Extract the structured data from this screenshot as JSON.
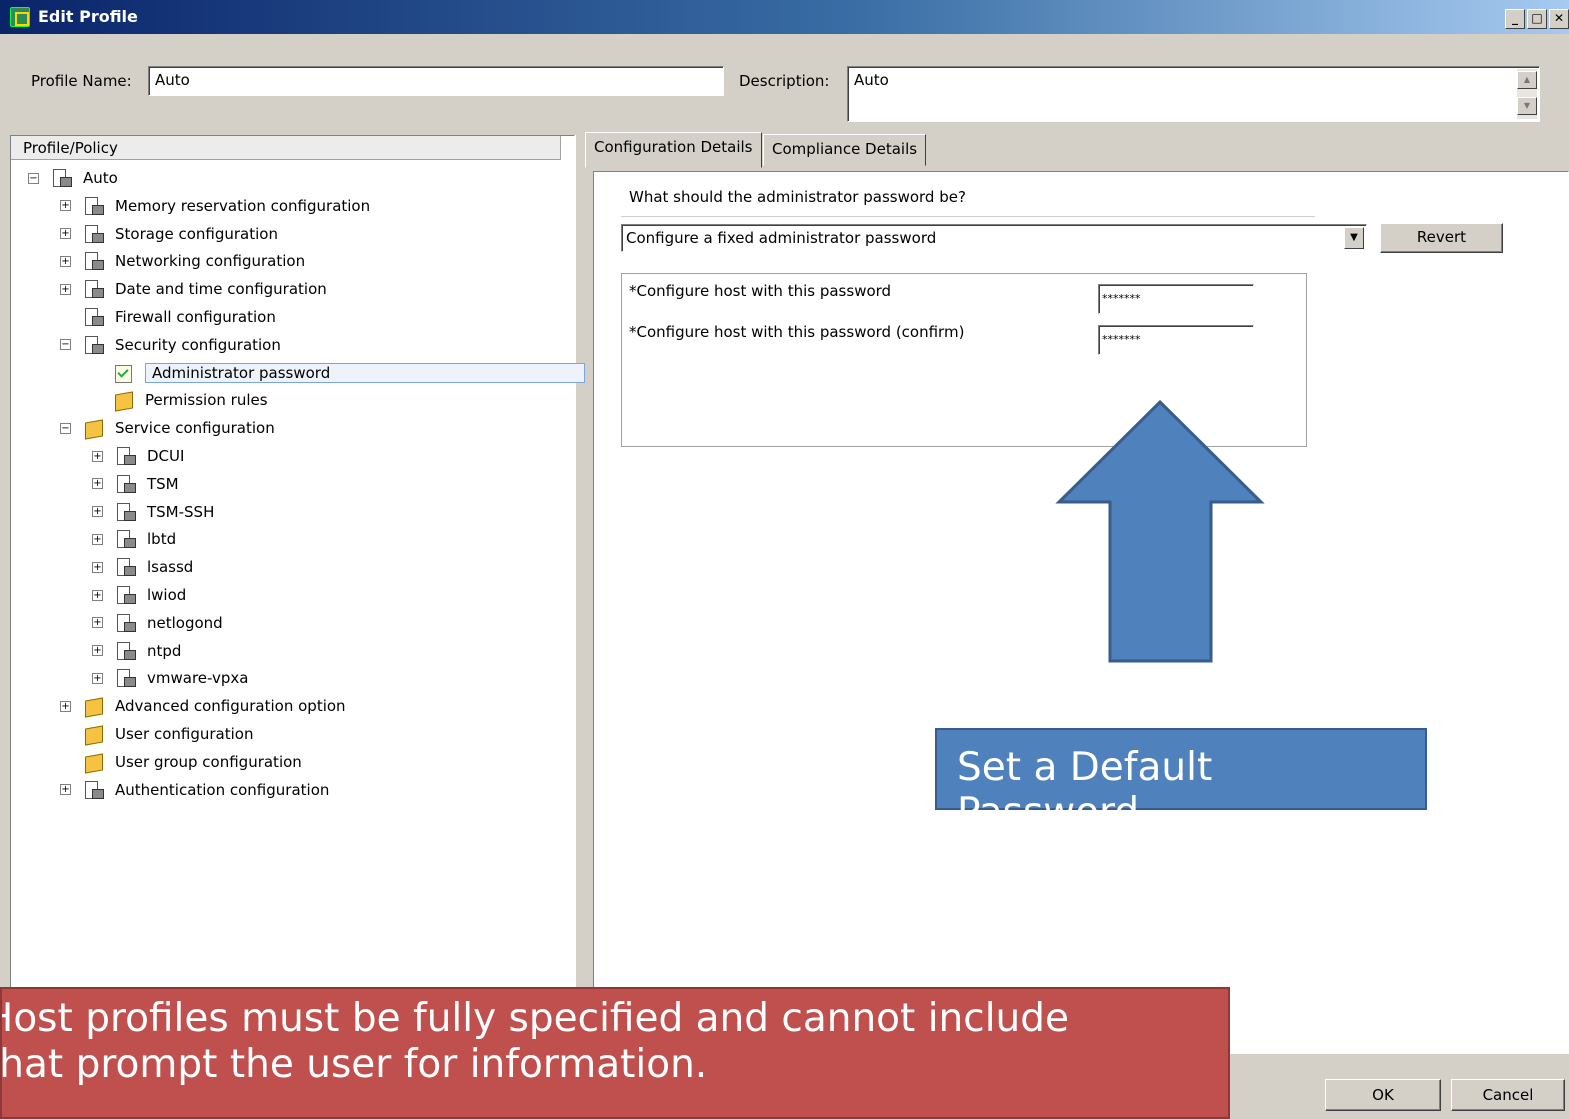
{
  "window": {
    "title": "Edit Profile",
    "controls": {
      "minimize": "_",
      "maximize": "□",
      "close": "✕"
    }
  },
  "header": {
    "profile_name_label": "Profile Name:",
    "profile_name_value": "Auto",
    "description_label": "Description:",
    "description_value": "Auto"
  },
  "tree": {
    "column_header": "Profile/Policy",
    "items": [
      {
        "label": "Auto",
        "expander": "−",
        "icon": "profile-icon"
      },
      {
        "label": "Memory reservation configuration",
        "expander": "+",
        "icon": "profile-icon"
      },
      {
        "label": "Storage configuration",
        "expander": "+",
        "icon": "profile-icon"
      },
      {
        "label": "Networking configuration",
        "expander": "+",
        "icon": "profile-icon"
      },
      {
        "label": "Date and time configuration",
        "expander": "+",
        "icon": "profile-icon"
      },
      {
        "label": "Firewall configuration",
        "expander": "",
        "icon": "profile-icon"
      },
      {
        "label": "Security configuration",
        "expander": "−",
        "icon": "profile-icon"
      },
      {
        "label": "Administrator password",
        "expander": "",
        "icon": "policy-check-icon"
      },
      {
        "label": "Permission rules",
        "expander": "",
        "icon": "folder-icon"
      },
      {
        "label": "Service configuration",
        "expander": "−",
        "icon": "folder-icon"
      },
      {
        "label": "DCUI",
        "expander": "+",
        "icon": "profile-icon"
      },
      {
        "label": "TSM",
        "expander": "+",
        "icon": "profile-icon"
      },
      {
        "label": "TSM-SSH",
        "expander": "+",
        "icon": "profile-icon"
      },
      {
        "label": "lbtd",
        "expander": "+",
        "icon": "profile-icon"
      },
      {
        "label": "lsassd",
        "expander": "+",
        "icon": "profile-icon"
      },
      {
        "label": "lwiod",
        "expander": "+",
        "icon": "profile-icon"
      },
      {
        "label": "netlogond",
        "expander": "+",
        "icon": "profile-icon"
      },
      {
        "label": "ntpd",
        "expander": "+",
        "icon": "profile-icon"
      },
      {
        "label": "vmware-vpxa",
        "expander": "+",
        "icon": "profile-icon"
      },
      {
        "label": "Advanced configuration option",
        "expander": "+",
        "icon": "folder-icon"
      },
      {
        "label": "User configuration",
        "expander": "",
        "icon": "folder-icon"
      },
      {
        "label": "User group configuration",
        "expander": "",
        "icon": "folder-icon"
      },
      {
        "label": "Authentication configuration",
        "expander": "+",
        "icon": "profile-icon"
      }
    ],
    "selected": "Administrator password"
  },
  "tabs": [
    {
      "label": "Configuration Details",
      "active": true
    },
    {
      "label": "Compliance Details",
      "active": false
    }
  ],
  "config": {
    "question": "What should the administrator password be?",
    "selected_option": "Configure a fixed administrator password",
    "revert_label": "Revert",
    "password_label": "*Configure host with this password",
    "password_value": "*******",
    "confirm_label": "*Configure host with this password (confirm)",
    "confirm_value": "*******"
  },
  "footer": {
    "ok_label": "OK",
    "cancel_label": "Cancel"
  },
  "annotations": {
    "blue_callout": "Set a Default Password",
    "red_callout_line1": "Host profiles must be fully specified and cannot include",
    "red_callout_line2": "that prompt the user for information."
  },
  "colors": {
    "title_gradient_start": "#0a246a",
    "blue_callout": "#4f81bd",
    "red_callout": "#c0504d",
    "window_face": "#d4d0c8"
  }
}
